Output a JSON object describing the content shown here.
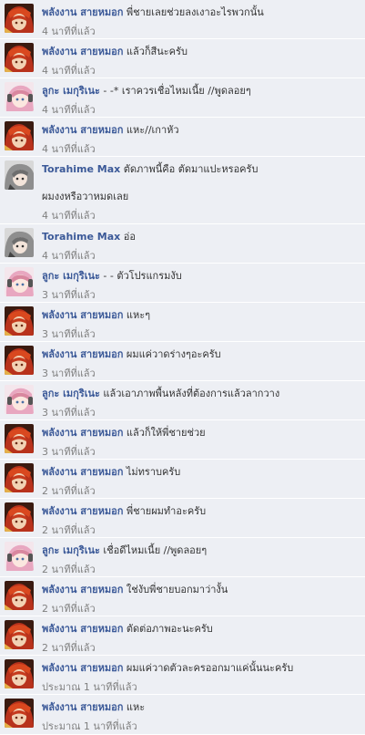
{
  "colors": {
    "background": "#edeff4",
    "author": "#3b5998",
    "text": "#333333",
    "time": "#808080"
  },
  "comments": [
    {
      "avatar": "avatar-red-hair-character",
      "author": "พลังงาน สายหมอก",
      "text": "พี่ชายเลยช่วยลงเงาอะไรพวกนั้น",
      "extra": "",
      "time": "4 นาทีที่แล้ว"
    },
    {
      "avatar": "avatar-red-hair-character",
      "author": "พลังงาน สายหมอก",
      "text": "แล้วก็สีนะครับ",
      "extra": "",
      "time": "4 นาทีที่แล้ว"
    },
    {
      "avatar": "avatar-pink-hair-headphones",
      "author": "ลูกะ เมกุริเนะ",
      "text": "- -* เราควรเชื่อไหมเนี้ย //พูดลอยๆ",
      "extra": "",
      "time": "4 นาทีที่แล้ว"
    },
    {
      "avatar": "avatar-red-hair-character",
      "author": "พลังงาน สายหมอก",
      "text": "แหะ//เกาหัว",
      "extra": "",
      "time": "4 นาทีที่แล้ว"
    },
    {
      "avatar": "avatar-gray-hair-character",
      "author": "Torahime Max",
      "text": "ตัดภาพนี้คือ ตัดมาแปะหรอครับ",
      "extra": "ผมงงหรือวาหมดเลย",
      "time": "4 นาทีที่แล้ว"
    },
    {
      "avatar": "avatar-gray-hair-character",
      "author": "Torahime Max",
      "text": "อ่อ",
      "extra": "",
      "time": "4 นาทีที่แล้ว"
    },
    {
      "avatar": "avatar-pink-hair-headphones",
      "author": "ลูกะ เมกุริเนะ",
      "text": "- - ตัวโปรแกรมงับ",
      "extra": "",
      "time": "3 นาทีที่แล้ว"
    },
    {
      "avatar": "avatar-red-hair-character",
      "author": "พลังงาน สายหมอก",
      "text": "แหะๆ",
      "extra": "",
      "time": "3 นาทีที่แล้ว"
    },
    {
      "avatar": "avatar-red-hair-character",
      "author": "พลังงาน สายหมอก",
      "text": "ผมแค่วาดร่างๆอะครับ",
      "extra": "",
      "time": "3 นาทีที่แล้ว"
    },
    {
      "avatar": "avatar-pink-hair-headphones",
      "author": "ลูกะ เมกุริเนะ",
      "text": "แล้วเอาภาพพื้นหลังที่ต้องการแล้วลากวาง",
      "extra": "",
      "time": "3 นาทีที่แล้ว"
    },
    {
      "avatar": "avatar-red-hair-character",
      "author": "พลังงาน สายหมอก",
      "text": "แล้วก็ให้พี่ชายช่วย",
      "extra": "",
      "time": "3 นาทีที่แล้ว"
    },
    {
      "avatar": "avatar-red-hair-character",
      "author": "พลังงาน สายหมอก",
      "text": "ไม่ทราบครับ",
      "extra": "",
      "time": "2 นาทีที่แล้ว"
    },
    {
      "avatar": "avatar-red-hair-character",
      "author": "พลังงาน สายหมอก",
      "text": "พี่ชายผมทำอะครับ",
      "extra": "",
      "time": "2 นาทีที่แล้ว"
    },
    {
      "avatar": "avatar-pink-hair-headphones",
      "author": "ลูกะ เมกุริเนะ",
      "text": "เชื่อดีไหมเนี้ย //พูดลอยๆ",
      "extra": "",
      "time": "2 นาทีที่แล้ว"
    },
    {
      "avatar": "avatar-red-hair-character",
      "author": "พลังงาน สายหมอก",
      "text": "ใช่งับพี่ชายบอกมาว่างั้น",
      "extra": "",
      "time": "2 นาทีที่แล้ว"
    },
    {
      "avatar": "avatar-red-hair-character",
      "author": "พลังงาน สายหมอก",
      "text": "ตัดต่อภาพอะนะครับ",
      "extra": "",
      "time": "2 นาทีที่แล้ว"
    },
    {
      "avatar": "avatar-red-hair-character",
      "author": "พลังงาน สายหมอก",
      "text": "ผมแค่วาดตัวละครออกมาแค่นั้นนะครับ",
      "extra": "",
      "time": "ประมาณ 1 นาทีที่แล้ว"
    },
    {
      "avatar": "avatar-red-hair-character",
      "author": "พลังงาน สายหมอก",
      "text": "แหะ",
      "extra": "",
      "time": "ประมาณ 1 นาทีที่แล้ว"
    }
  ]
}
